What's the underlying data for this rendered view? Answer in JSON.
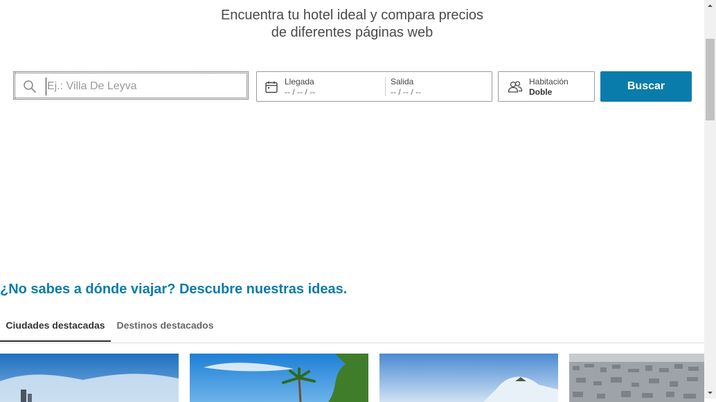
{
  "hero": {
    "line1": "Encuentra tu hotel ideal y compara precios",
    "line2": "de diferentes páginas web"
  },
  "search": {
    "placeholder": "Ej.: Villa De Leyva",
    "icon": "search-icon"
  },
  "dates": {
    "icon": "calendar-icon",
    "arrival_label": "Llegada",
    "arrival_value": "-- / -- / --",
    "departure_label": "Salida",
    "departure_value": "-- / -- / --"
  },
  "room": {
    "icon": "guests-icon",
    "label": "Habitación",
    "value": "Doble"
  },
  "search_button": "Buscar",
  "ideas": {
    "heading": "¿No sabes a dónde viajar? Descubre nuestras ideas.",
    "tabs": [
      {
        "label": "Ciudades destacadas",
        "active": true
      },
      {
        "label": "Destinos destacados",
        "active": false
      }
    ]
  },
  "colors": {
    "accent": "#0a7cab",
    "text": "#4a4a4a"
  }
}
